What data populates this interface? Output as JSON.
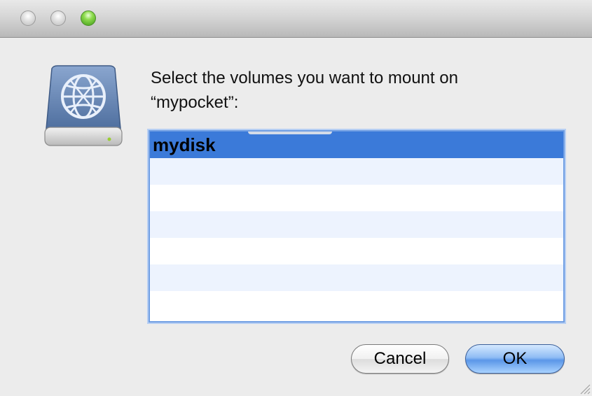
{
  "window": {
    "controls": [
      "close",
      "minimize",
      "zoom"
    ]
  },
  "dialog": {
    "icon": "network-drive-icon",
    "prompt": "Select the volumes you want to mount on\n“mypocket”:",
    "volumes": [
      {
        "label": "mydisk",
        "selected": true
      }
    ]
  },
  "buttons": {
    "cancel_label": "Cancel",
    "ok_label": "OK"
  },
  "colors": {
    "selection": "#3b7ad9",
    "stripe": "#edf3fe",
    "focus_ring": "#6f9ee3"
  }
}
